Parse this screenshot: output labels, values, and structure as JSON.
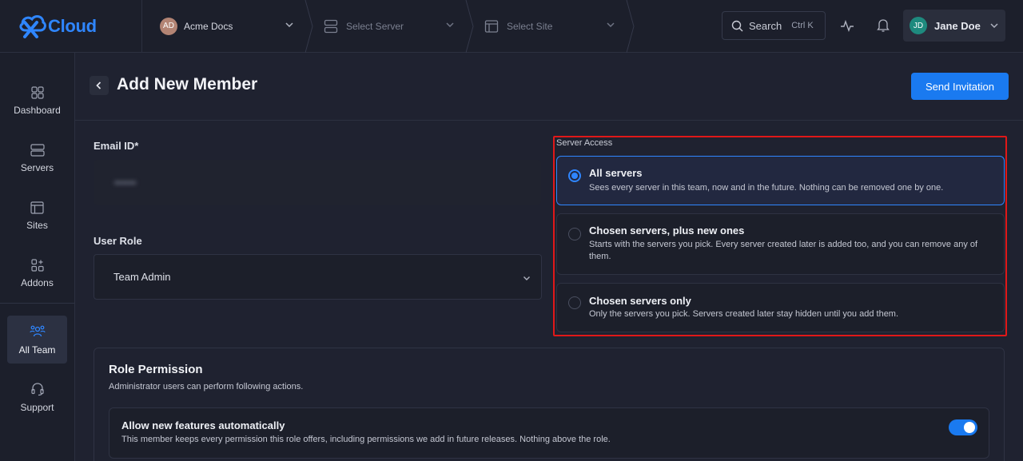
{
  "brand": {
    "name": "Cloud"
  },
  "breadcrumbs": [
    {
      "label": "Acme Docs",
      "avatar": "AD"
    },
    {
      "label": "Select Server"
    },
    {
      "label": "Select Site"
    }
  ],
  "search": {
    "label": "Search",
    "shortcut": "Ctrl K"
  },
  "user": {
    "name": "Jane Doe",
    "initials": "JD"
  },
  "sidebar": {
    "items": [
      {
        "label": "Dashboard",
        "icon": "dashboard-icon"
      },
      {
        "label": "Servers",
        "icon": "server-icon"
      },
      {
        "label": "Sites",
        "icon": "site-icon"
      },
      {
        "label": "Addons",
        "icon": "addons-icon"
      },
      {
        "label": "All Team",
        "icon": "team-icon",
        "active": true
      },
      {
        "label": "Support",
        "icon": "headset-icon"
      }
    ]
  },
  "page": {
    "title": "Add New Member",
    "send_button": "Send Invitation"
  },
  "form": {
    "email_label": "Email ID*",
    "email_value": "••••••",
    "role_label": "User Role",
    "role_value": "Team Admin"
  },
  "server_access": {
    "label": "Server Access",
    "options": [
      {
        "title": "All servers",
        "description": "Sees every server in this team, now and in the future. Nothing can be removed one by one.",
        "selected": true
      },
      {
        "title": "Chosen servers, plus new ones",
        "description": "Starts with the servers you pick. Every server created later is added too, and you can remove any of them.",
        "selected": false
      },
      {
        "title": "Chosen servers only",
        "description": "Only the servers you pick. Servers created later stay hidden until you add them.",
        "selected": false
      }
    ]
  },
  "permissions": {
    "title": "Role Permission",
    "subtitle": "Administrator users can perform following actions.",
    "items": [
      {
        "title": "Allow new features automatically",
        "description": "This member keeps every permission this role offers, including permissions we add in future releases. Nothing above the role.",
        "enabled": true
      }
    ]
  },
  "colors": {
    "accent": "#1a7af0",
    "highlight_border": "#e01818"
  }
}
